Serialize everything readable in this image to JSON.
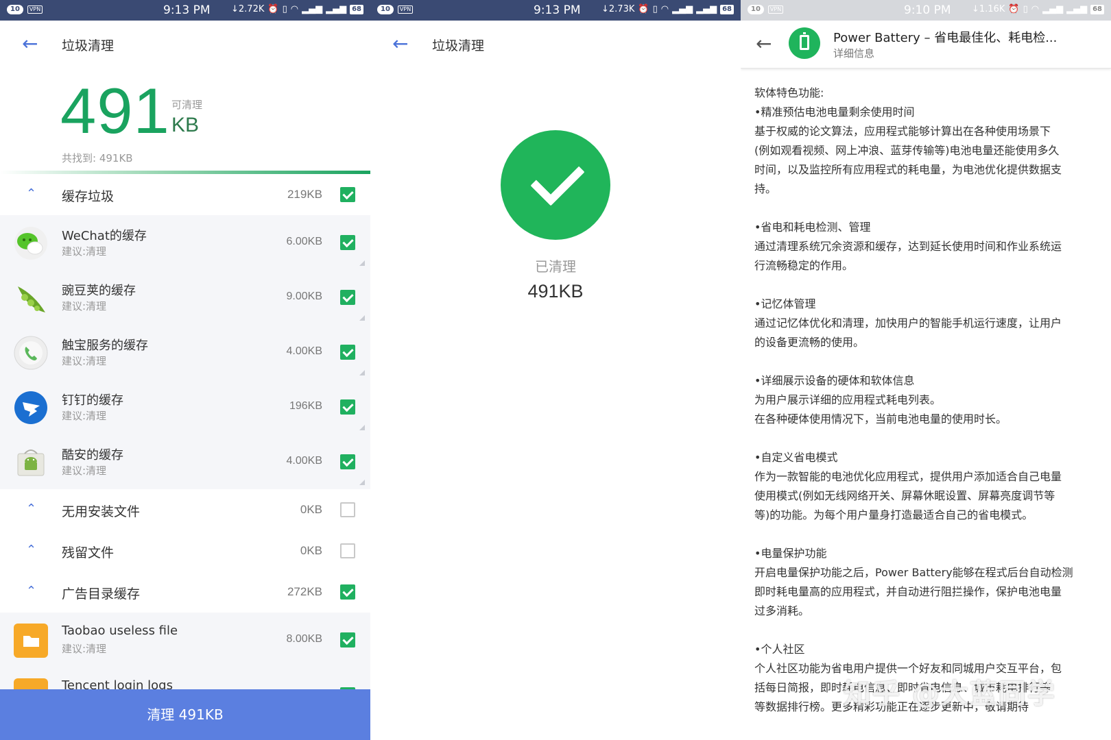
{
  "status_bars": [
    {
      "badge": "10",
      "vpn": "VPN",
      "time": "9:13 PM",
      "net": "↓2.72K",
      "battery": "68"
    },
    {
      "badge": "10",
      "vpn": "VPN",
      "time": "9:13 PM",
      "net": "↓2.73K",
      "battery": "68"
    },
    {
      "badge": "10",
      "vpn": "VPN",
      "time": "9:10 PM",
      "net": "↓1.16K",
      "battery": "68"
    }
  ],
  "junk": {
    "title": "垃圾清理",
    "amount": "491",
    "small_label": "可清理",
    "unit": "KB",
    "found": "共找到: 491KB",
    "progress": 1.0,
    "categories": [
      {
        "label": "缓存垃圾",
        "size": "219KB",
        "checked": true
      },
      {
        "label": "无用安装文件",
        "size": "0KB",
        "checked": false
      },
      {
        "label": "残留文件",
        "size": "0KB",
        "checked": false
      },
      {
        "label": "广告目录缓存",
        "size": "272KB",
        "checked": true
      }
    ],
    "cache_items": [
      {
        "name": "WeChat的缓存",
        "sub": "建议:清理",
        "size": "6.00KB",
        "icon": "wechat-icon"
      },
      {
        "name": "豌豆荚的缓存",
        "sub": "建议:清理",
        "size": "9.00KB",
        "icon": "peapod-icon"
      },
      {
        "name": "触宝服务的缓存",
        "sub": "建议:清理",
        "size": "4.00KB",
        "icon": "phone-icon"
      },
      {
        "name": "钉钉的缓存",
        "sub": "建议:清理",
        "size": "196KB",
        "icon": "dingtalk-icon"
      },
      {
        "name": "酷安的缓存",
        "sub": "建议:清理",
        "size": "4.00KB",
        "icon": "android-icon"
      }
    ],
    "ad_items": [
      {
        "name": "Taobao useless file",
        "sub": "建议:清理",
        "size": "8.00KB",
        "icon": "folder-icon"
      },
      {
        "name": "Tencent login logs",
        "sub": "",
        "size": "",
        "icon": "folder-icon"
      }
    ],
    "clean_button": "清理 491KB"
  },
  "done": {
    "title": "垃圾清理",
    "label": "已清理",
    "size": "491KB"
  },
  "detail": {
    "app_title": "Power Battery – 省电最佳化、耗电检...",
    "subtitle": "详细信息",
    "lines": [
      "软体特色功能:",
      "•精准预估电池电量剩余使用时间",
      "基于权威的论文算法，应用程式能够计算出在各种使用场景下",
      "(例如观看视频、网上冲浪、蓝芽传输等)电池电量还能使用多久",
      "时间，以及监控所有应用程式的耗电量，为电池优化提供数据支",
      "持。",
      "",
      "•省电和耗电检测、管理",
      "通过清理系统冗余资源和缓存，达到延长使用时间和作业系统运",
      "行流畅稳定的作用。",
      "",
      "•记忆体管理",
      "通过记忆体优化和清理，加快用户的智能手机运行速度，让用户",
      "的设备更流畅的使用。",
      "",
      "•详细展示设备的硬体和软体信息",
      "为用户展示详细的应用程式耗电列表。",
      "在各种硬体使用情况下，当前电池电量的使用时长。",
      "",
      "•自定义省电模式",
      "作为一款智能的电池优化应用程式，提供用户添加适合自己电量",
      "使用模式(例如无线网络开关、屏幕休眠设置、屏幕亮度调节等",
      "等)的功能。为每个用户量身打造最适合自己的省电模式。",
      "",
      "•电量保护功能",
      "开启电量保护功能之后，Power Battery能够在程式后台自动检测",
      "即时耗电量高的应用程式，并自动进行阻拦操作，保护电池电量",
      "过多消耗。",
      "",
      "•个人社区",
      "个人社区功能为省电用户提供一个好友和同城用户交互平台，包",
      "括每日简报，即时耗电信息、即时省电信息、城市耗电排行等",
      "等数据排行榜。更多精彩功能正在逐步更新中，敬请期待"
    ],
    "watermark": "知乎 @大蓝同学"
  }
}
